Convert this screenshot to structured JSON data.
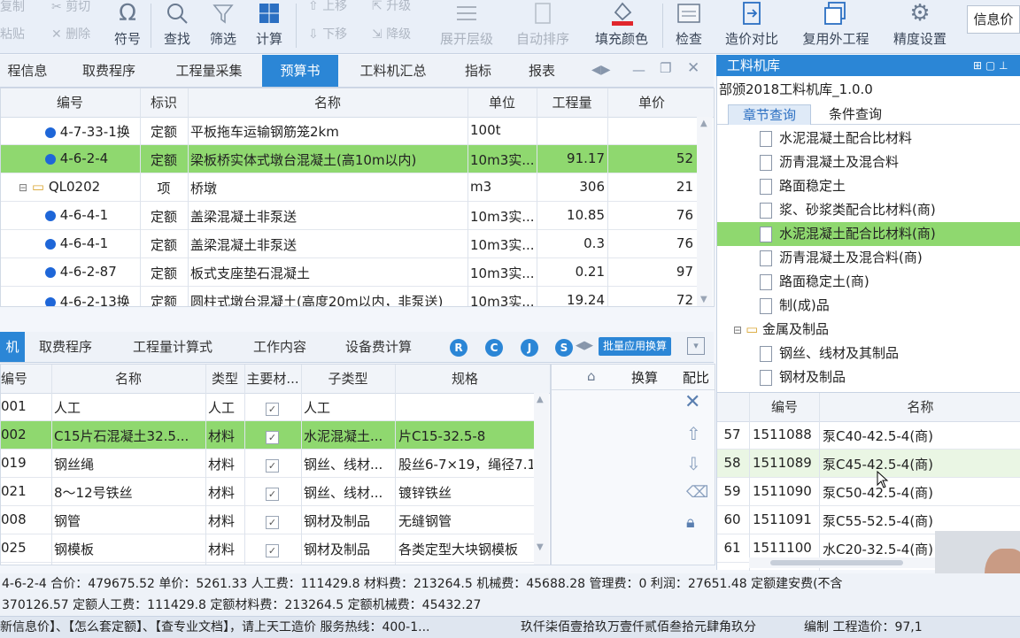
{
  "ribbon": {
    "copy": "复制",
    "cut": "剪切",
    "paste": "粘贴",
    "delete": "删除",
    "symbol": "符号",
    "find": "查找",
    "filter": "筛选",
    "calc": "计算",
    "move_up": "上移",
    "upgrade": "升级",
    "move_down": "下移",
    "downgrade": "降级",
    "expand": "展开层级",
    "auto_sort": "自动排序",
    "fill_color": "填充颜色",
    "check": "检查",
    "price_compare": "造价对比",
    "reuse": "复用外工程",
    "precision": "精度设置",
    "info_price": "信息价"
  },
  "top_tabs": [
    "程信息",
    "取费程序",
    "工程量采集",
    "预算书",
    "工料机汇总",
    "指标",
    "报表"
  ],
  "top_tab_active": 3,
  "budget_table": {
    "headers": [
      "编号",
      "标识",
      "名称",
      "单位",
      "工程量",
      "单价"
    ],
    "rows": [
      {
        "code": "4-7-33-1换",
        "tag": "定额",
        "name": "平板拖车运输钢筋笼2km",
        "unit": "100t",
        "qty": "",
        "price": ""
      },
      {
        "code": "4-6-2-4",
        "tag": "定额",
        "name": "梁板桥实体式墩台混凝土(高10m以内)",
        "unit": "10m3实...",
        "qty": "91.17",
        "price": "52"
      },
      {
        "code": "QL0202",
        "tag": "项",
        "name": "桥墩",
        "unit": "m3",
        "qty": "306",
        "price": "21"
      },
      {
        "code": "4-6-4-1",
        "tag": "定额",
        "name": "盖梁混凝土非泵送",
        "unit": "10m3实...",
        "qty": "10.85",
        "price": "76"
      },
      {
        "code": "4-6-4-1",
        "tag": "定额",
        "name": "盖梁混凝土非泵送",
        "unit": "10m3实...",
        "qty": "0.3",
        "price": "76"
      },
      {
        "code": "4-6-2-87",
        "tag": "定额",
        "name": "板式支座垫石混凝土",
        "unit": "10m3实...",
        "qty": "0.21",
        "price": "97"
      },
      {
        "code": "4-6-2-13换",
        "tag": "定额",
        "name": "圆柱式墩台混凝土(高度20m以内，非泵送)",
        "unit": "10m3实...",
        "qty": "19.24",
        "price": "72"
      }
    ]
  },
  "bottom_tabs": [
    "机",
    "取费程序",
    "工程量计算式",
    "工作内容",
    "设备费计算"
  ],
  "circle_buttons": [
    "R",
    "C",
    "J",
    "S"
  ],
  "batch_button": "批量应用换算",
  "material_table": {
    "headers": [
      "编号",
      "名称",
      "类型",
      "主要材...",
      "子类型",
      "规格"
    ],
    "rows": [
      {
        "code": "001",
        "name": "人工",
        "type": "人工",
        "sub": "人工",
        "spec": ""
      },
      {
        "code": "002",
        "name": "C15片石混凝土32.5...",
        "type": "材料",
        "sub": "水泥混凝土...",
        "spec": "片C15-32.5-8"
      },
      {
        "code": "019",
        "name": "钢丝绳",
        "type": "材料",
        "sub": "钢丝、线材...",
        "spec": "股丝6-7×19，绳径7.1"
      },
      {
        "code": "021",
        "name": "8～12号铁丝",
        "type": "材料",
        "sub": "钢丝、线材...",
        "spec": "镀锌铁丝"
      },
      {
        "code": "008",
        "name": "钢管",
        "type": "材料",
        "sub": "钢材及制品",
        "spec": "无缝钢管"
      },
      {
        "code": "025",
        "name": "钢模板",
        "type": "材料",
        "sub": "钢材及制品",
        "spec": "各类定型大块钢模板"
      }
    ]
  },
  "mid_tabs": [
    "换算",
    "配比"
  ],
  "right_panel": {
    "title": "工料机库",
    "library": "部颁2018工料机库_1.0.0",
    "tabs": [
      "章节查询",
      "条件查询"
    ],
    "tree": [
      "水泥混凝土配合比材料",
      "沥青混凝土及混合料",
      "路面稳定土",
      "浆、砂浆类配合比材料(商)",
      "水泥混凝土配合比材料(商)",
      "沥青混凝土及混合料(商)",
      "路面稳定土(商)",
      "制(成)品",
      "金属及制品",
      "钢丝、线材及其制品",
      "钢材及制品"
    ],
    "tree_selected": 4,
    "list_headers": [
      "编号",
      "名称"
    ],
    "list_rows": [
      {
        "idx": "57",
        "code": "1511088",
        "name": "泵C40-42.5-4(商)"
      },
      {
        "idx": "58",
        "code": "1511089",
        "name": "泵C45-42.5-4(商)"
      },
      {
        "idx": "59",
        "code": "1511090",
        "name": "泵C50-42.5-4(商)"
      },
      {
        "idx": "60",
        "code": "1511091",
        "name": "泵C55-52.5-4(商)"
      },
      {
        "idx": "61",
        "code": "1511100",
        "name": "水C20-32.5-4(商)"
      }
    ]
  },
  "status": {
    "line1": "4-6-2-4   合价：479675.52   单价：5261.33   人工费：111429.8   材料费：213264.5   机械费：45688.28   管理费：0   利润：27651.48   定额建安费(不含",
    "line2": "370126.57   定额人工费：111429.8   定额材料费：213264.5   定额机械费：45432.27",
    "line3_left": "新信息价】、【怎么套定额】、【查专业文档】，请上天工造价 服务热线：400-1...",
    "line3_mid": "玖仟柒佰壹拾玖万壹仟贰佰叁拾元肆角玖分",
    "line3_right": "编制   工程造价：97,1"
  },
  "colors": {
    "accent": "#2b86d6",
    "selected_row": "#8fd86f",
    "fill_red": "#e0262c"
  }
}
